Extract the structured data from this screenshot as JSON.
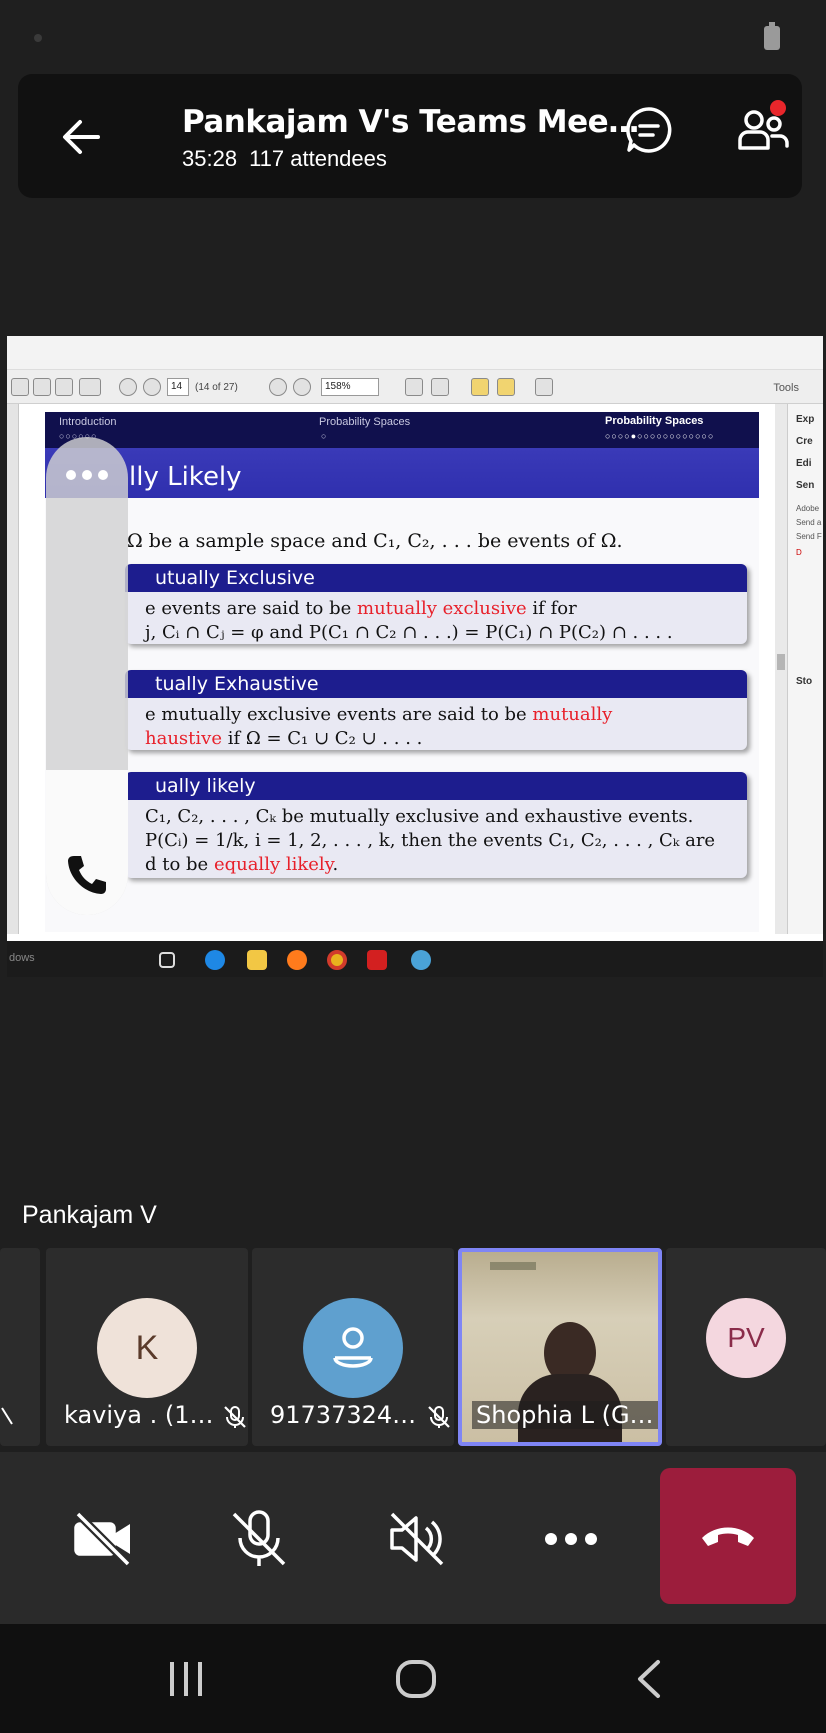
{
  "meeting": {
    "title": "Pankajam V's Teams Mee…",
    "duration": "35:28",
    "attendees": "117 attendees"
  },
  "shared_screen": {
    "toolbar": {
      "page_input": "14",
      "page_of": "(14 of 27)",
      "zoom": "158%",
      "tools_label": "Tools"
    },
    "right_panel": {
      "items": [
        "Exp",
        "Cre",
        "Edi",
        "Sen",
        "Sto"
      ],
      "small_lines": [
        "Adobe",
        "Send a",
        "Send F",
        "D"
      ]
    },
    "slide": {
      "nav_left": "Introduction",
      "nav_left_dots": "○○○○○○",
      "nav_center": "Probability Spaces",
      "nav_center_dots": "○",
      "nav_right": "Probability Spaces",
      "nav_right_dots": "○○○○●○○○○○○○○○○○○",
      "title": "lly Likely",
      "intro": "Ω be a sample space and C₁, C₂, . . . be events of Ω.",
      "boxes": [
        {
          "heading": "utually Exclusive",
          "line1_pre": "e events are said to be ",
          "line1_red": "mutually exclusive",
          "line1_post": " if for",
          "line2": "j,  Cᵢ ∩ Cⱼ = φ and P(C₁ ∩ C₂ ∩ . . .) = P(C₁) ∩ P(C₂) ∩ . . . ."
        },
        {
          "heading": "tually Exhaustive",
          "line1_pre": "e mutually exclusive events are said to be ",
          "line1_red": "mutually",
          "line2_red": "haustive",
          "line2_post": " if Ω = C₁ ∪ C₂ ∪ . . . ."
        },
        {
          "heading": "ually likely",
          "line1": "C₁, C₂, . . . , Cₖ be mutually exclusive and exhaustive events.",
          "line2": "P(Cᵢ) = 1/k, i = 1, 2, . . . , k, then the events C₁, C₂, . . . , Cₖ are",
          "line3_pre": "d to be ",
          "line3_red": "equally likely",
          "line3_post": "."
        }
      ]
    },
    "taskbar_label": "dows"
  },
  "presenter_name": "Pankajam V",
  "participants": [
    {
      "name": "kaviya . (1…",
      "initial": "K",
      "muted": true
    },
    {
      "name": "91737324…",
      "initial": "",
      "muted": true
    },
    {
      "name": "Shophia L (G…",
      "initial": "",
      "video": true
    },
    {
      "name": "",
      "initial": "PV"
    }
  ],
  "colors": {
    "hangup": "#9c1d3c",
    "slide_title_bar": "#3030b0",
    "box_header": "#1d1d8e",
    "highlight_red": "#e8202a",
    "avatar_k_bg": "#efe2d9",
    "avatar_phone_bg": "#5fa0cf",
    "avatar_pv_bg": "#f4d7df"
  }
}
